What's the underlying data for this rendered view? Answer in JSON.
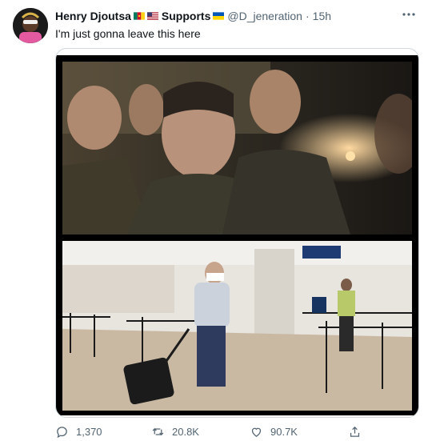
{
  "tweet": {
    "author_name": "Henry Djoutsa",
    "supports_label": "Supports",
    "handle": "@D_jeneration",
    "separator": "·",
    "time": "15h",
    "text": "I'm just gonna leave this here",
    "more_icon": "ellipsis-icon"
  },
  "actions": {
    "reply_count": "1,370",
    "retweet_count": "20.8K",
    "like_count": "90.7K"
  },
  "colors": {
    "text": "#0f1419",
    "secondary": "#536471",
    "border": "#cfd9de"
  }
}
